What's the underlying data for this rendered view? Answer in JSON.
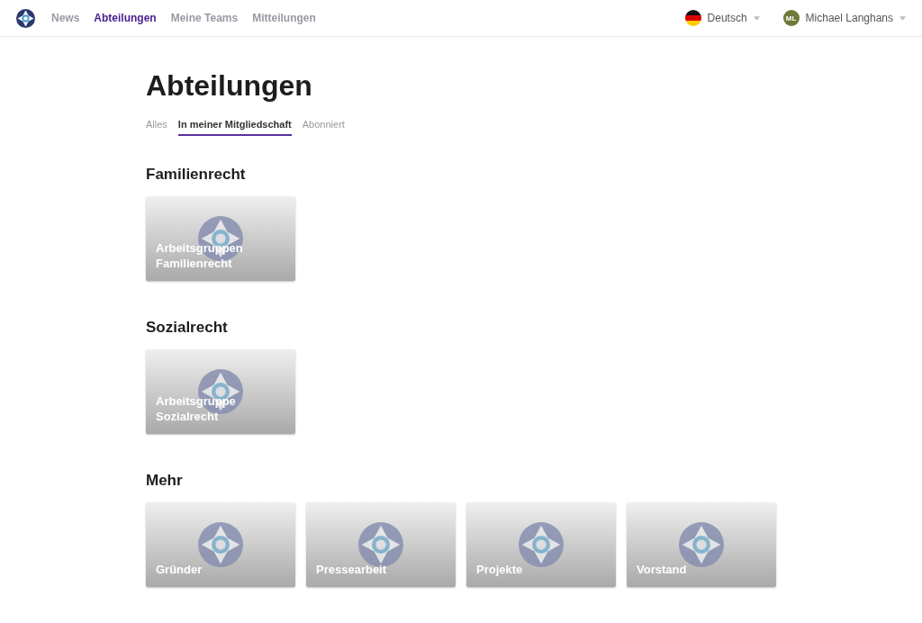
{
  "nav": {
    "items": [
      {
        "label": "News",
        "selected": false
      },
      {
        "label": "Abteilungen",
        "selected": true
      },
      {
        "label": "Meine Teams",
        "selected": false
      },
      {
        "label": "Mitteilungen",
        "selected": false
      }
    ],
    "language": "Deutsch",
    "user": {
      "initials": "ML",
      "name": "Michael Langhans"
    }
  },
  "page": {
    "title": "Abteilungen",
    "tabs": [
      {
        "label": "Alles",
        "selected": false
      },
      {
        "label": "In meiner Mitgliedschaft",
        "selected": true
      },
      {
        "label": "Abonniert",
        "selected": false
      }
    ]
  },
  "sections": [
    {
      "title": "Familienrecht",
      "cards": [
        {
          "title": "Arbeitsgruppen Familienrecht"
        }
      ]
    },
    {
      "title": "Sozialrecht",
      "cards": [
        {
          "title": "Arbeitsgruppe Sozialrecht"
        }
      ]
    },
    {
      "title": "Mehr",
      "cards": [
        {
          "title": "Gründer"
        },
        {
          "title": "Pressearbeit"
        },
        {
          "title": "Projekte"
        },
        {
          "title": "Vorstand"
        }
      ]
    }
  ]
}
